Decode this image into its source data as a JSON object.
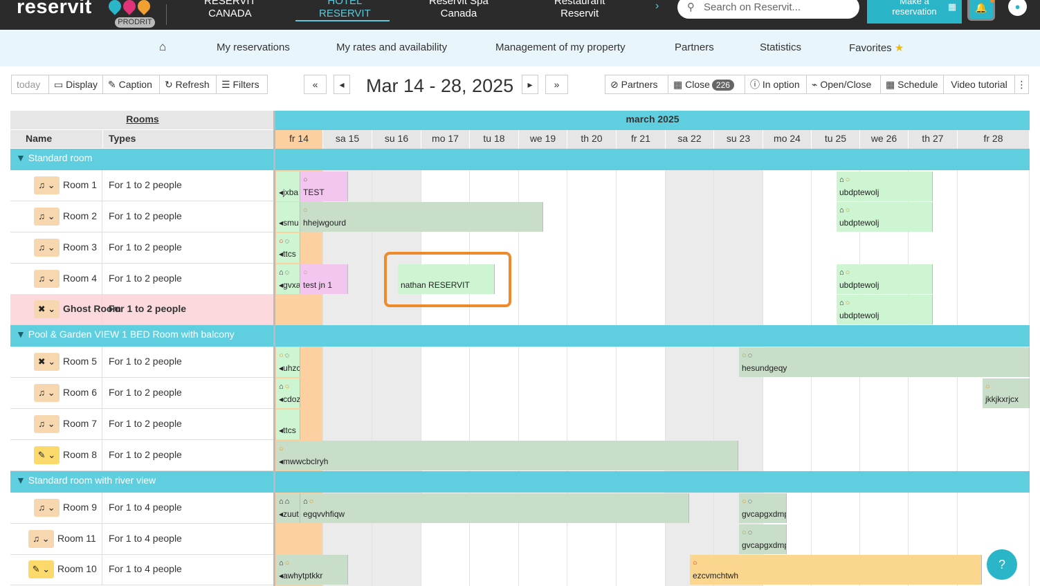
{
  "topbar": {
    "logo": "reservit",
    "badge": "PRODRIT",
    "tabs": [
      {
        "l1": "RESERVIT",
        "l2": "CANADA"
      },
      {
        "l1": "HOTEL",
        "l2": "RESERVIT"
      },
      {
        "l1": "Reservit Spa",
        "l2": "Canada"
      },
      {
        "l1": "Restaurant",
        "l2": "Reservit"
      }
    ],
    "search_placeholder": "Search on Reservit...",
    "make_res_l1": "Make a",
    "make_res_l2": "reservation"
  },
  "secnav": [
    "My reservations",
    "My rates and availability",
    "Management of my property",
    "Partners",
    "Statistics",
    "Favorites"
  ],
  "toolbar": {
    "today": "today",
    "display": "Display",
    "caption": "Caption",
    "refresh": "Refresh",
    "filters": "Filters",
    "date_range": "Mar 14 - 28, 2025",
    "partners": "Partners",
    "close": "Close",
    "close_count": "226",
    "in_option": "In option",
    "open_close": "Open/Close",
    "schedule": "Schedule",
    "video": "Video tutorial"
  },
  "grid": {
    "rooms_header": "Rooms",
    "name_header": "Name",
    "types_header": "Types",
    "month": "march 2025",
    "days": [
      "fr 14",
      "sa 15",
      "su 16",
      "mo 17",
      "tu 18",
      "we 19",
      "th 20",
      "fr 21",
      "sa 22",
      "su 23",
      "mo 24",
      "tu 25",
      "we 26",
      "th 27",
      "fr 28"
    ],
    "categories": [
      "Standard room",
      "Pool & Garden VIEW 1 BED Room with balcony",
      "Standard room with river view"
    ],
    "rooms": [
      {
        "name": "Room 1",
        "type": "For 1 to 2 people"
      },
      {
        "name": "Room 2",
        "type": "For 1 to 2 people"
      },
      {
        "name": "Room 3",
        "type": "For 1 to 2 people"
      },
      {
        "name": "Room 4",
        "type": "For 1 to 2 people"
      },
      {
        "name": "Ghost Room",
        "type": "For 1 to 2 people"
      },
      {
        "name": "Room 5",
        "type": "For 1 to 2 people"
      },
      {
        "name": "Room 6",
        "type": "For 1 to 2 people"
      },
      {
        "name": "Room 7",
        "type": "For 1 to 2 people"
      },
      {
        "name": "Room 8",
        "type": "For 1 to 2 people"
      },
      {
        "name": "Room 9",
        "type": "For 1 to 4 people"
      },
      {
        "name": "Room 11",
        "type": "For 1 to 4 people"
      },
      {
        "name": "Room 10",
        "type": "For 1 to 4 people"
      }
    ],
    "reservations": {
      "r1a": "jxba",
      "r1b": "TEST",
      "r1c": "ubdptewolj",
      "r2a": "smu",
      "r2b": "hhejwgourd",
      "r2c": "ubdptewolj",
      "r3a": "ttcs",
      "r4a": "gvxa",
      "r4b": "test jn 1",
      "r4c": "nathan RESERVIT",
      "r4d": "ubdptewolj",
      "rga": "ubdptewolj",
      "r5a": "uhzc",
      "r5b": "hesundgeqy",
      "r6a": "cdoz",
      "r6b": "jkkjkxrjcx",
      "r7a": "ttcs",
      "r8a": "mwwcbclryh",
      "r9a": "zuut",
      "r9b": "egqvvhfiqw",
      "r9c": "gvcapgxdmp",
      "r11a": "gvcapgxdmp",
      "r10a": "awhytptkkr",
      "r10b": "ezcvmchtwh"
    }
  },
  "help": "?"
}
